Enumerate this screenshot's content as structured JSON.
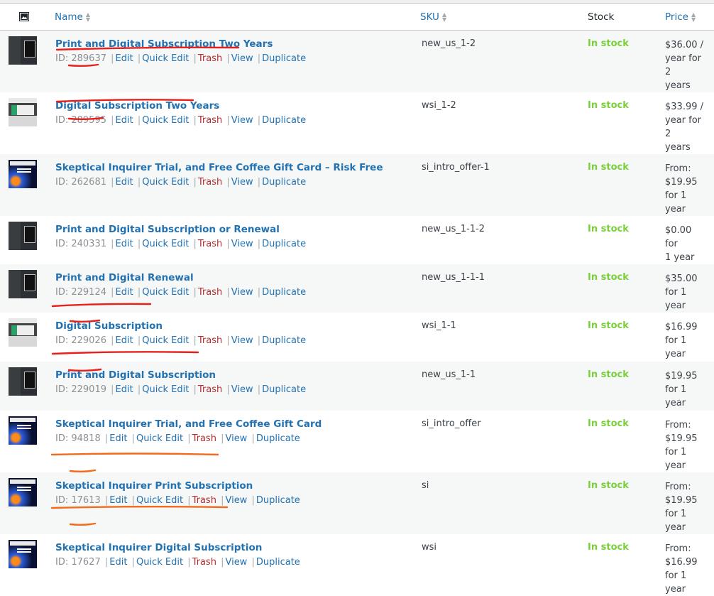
{
  "columns": {
    "image_icon": "image-icon",
    "name": "Name",
    "sku": "SKU",
    "stock": "Stock",
    "price": "Price"
  },
  "row_actions": {
    "id_prefix": "ID: ",
    "edit": "Edit",
    "quick_edit": "Quick Edit",
    "trash": "Trash",
    "view": "View",
    "duplicate": "Duplicate",
    "separator": "|"
  },
  "products": [
    {
      "thumb": "print",
      "name": "Print and Digital Subscription Two Years",
      "id": "289637",
      "sku": "new_us_1-2",
      "stock": "In stock",
      "price": [
        "$36.00 /",
        "year for 2",
        "years"
      ]
    },
    {
      "thumb": "digital",
      "name": "Digital Subscription Two Years",
      "id": "289595",
      "sku": "wsi_1-2",
      "stock": "In stock",
      "price": [
        "$33.99 /",
        "year for 2",
        "years"
      ]
    },
    {
      "thumb": "mag",
      "name": "Skeptical Inquirer Trial, and Free Coffee Gift Card – Risk Free",
      "id": "262681",
      "sku": "si_intro_offer-1",
      "stock": "In stock",
      "price": [
        "From:",
        "$19.95",
        "for 1 year"
      ]
    },
    {
      "thumb": "print",
      "name": "Print and Digital Subscription or Renewal",
      "id": "240331",
      "sku": "new_us_1-1-2",
      "stock": "In stock",
      "price": [
        "$0.00 for",
        "1 year"
      ]
    },
    {
      "thumb": "print",
      "name": "Print and Digital Renewal",
      "id": "229124",
      "sku": "new_us_1-1-1",
      "stock": "In stock",
      "price": [
        "$35.00",
        "for 1 year"
      ]
    },
    {
      "thumb": "digital",
      "name": "Digital Subscription",
      "id": "229026",
      "sku": "wsi_1-1",
      "stock": "In stock",
      "price": [
        "$16.99",
        "for 1 year"
      ]
    },
    {
      "thumb": "print",
      "name": "Print and Digital Subscription",
      "id": "229019",
      "sku": "new_us_1-1",
      "stock": "In stock",
      "price": [
        "$19.95",
        "for 1 year"
      ]
    },
    {
      "thumb": "mag",
      "name": "Skeptical Inquirer Trial, and Free Coffee Gift Card",
      "id": "94818",
      "sku": "si_intro_offer",
      "stock": "In stock",
      "price": [
        "From:",
        "$19.95",
        "for 1 year"
      ]
    },
    {
      "thumb": "mag",
      "name": "Skeptical Inquirer Print Subscription",
      "id": "17613",
      "sku": "si",
      "stock": "In stock",
      "price": [
        "From:",
        "$19.95",
        "for 1 year"
      ]
    },
    {
      "thumb": "mag",
      "name": "Skeptical Inquirer Digital Subscription",
      "id": "17627",
      "sku": "wsi",
      "stock": "In stock",
      "price": [
        "From:",
        "$16.99",
        "for 1 year"
      ]
    }
  ],
  "annotation_colors": {
    "red": "#e8201c",
    "orange": "#f26a1b"
  }
}
